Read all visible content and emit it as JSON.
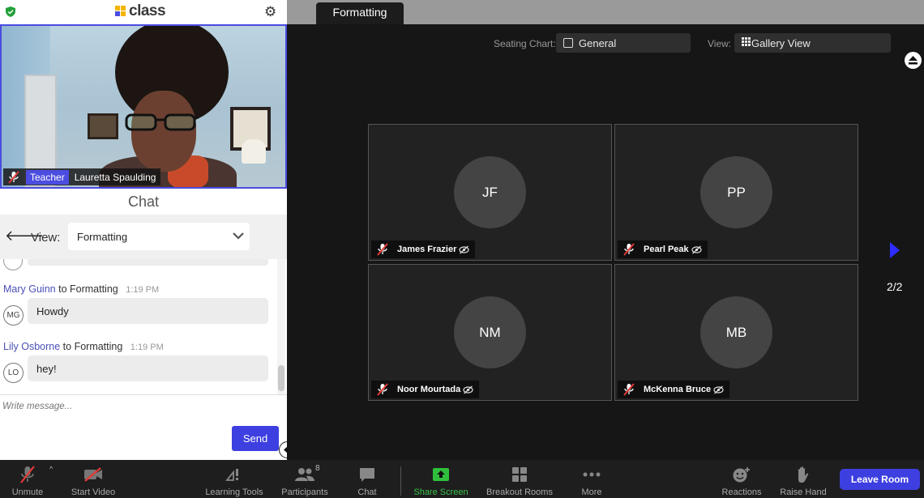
{
  "app": {
    "logo_text": "class"
  },
  "self_video": {
    "role_badge": "Teacher",
    "name": "Lauretta Spaulding"
  },
  "chat": {
    "title": "Chat",
    "view_label": "View:",
    "view_value": "Formatting",
    "messages": [
      {
        "sender": "Mary Guinn",
        "to_text": "to Formatting",
        "time": "1:19 PM",
        "initials": "MG",
        "text": "Howdy"
      },
      {
        "sender": "Lily Osborne",
        "to_text": "to Formatting",
        "time": "1:19 PM",
        "initials": "LO",
        "text": "hey!"
      }
    ],
    "compose_placeholder": "Write message...",
    "send_label": "Send"
  },
  "room_tab": "Formatting",
  "seating": {
    "label": "Seating Chart:",
    "value": "General"
  },
  "view_mode": {
    "label": "View:",
    "value": "Gallery View"
  },
  "participants": [
    {
      "initials": "JF",
      "name": "James Frazier"
    },
    {
      "initials": "PP",
      "name": "Pearl Peak"
    },
    {
      "initials": "NM",
      "name": "Noor Mourtada"
    },
    {
      "initials": "MB",
      "name": "McKenna Bruce"
    }
  ],
  "pager": "2/2",
  "toolbar": {
    "unmute": "Unmute",
    "start_video": "Start Video",
    "learning_tools": "Learning Tools",
    "participants": "Participants",
    "participants_count": "8",
    "chat": "Chat",
    "share_screen": "Share Screen",
    "breakout_rooms": "Breakout Rooms",
    "more": "More",
    "reactions": "Reactions",
    "raise_hand": "Raise Hand",
    "leave_room": "Leave Room"
  },
  "colors": {
    "accent": "#3d3fe0",
    "share_green": "#3cc24a",
    "stage_bg": "#161616",
    "sender_name": "#4a4fb8"
  },
  "icons": [
    "shield-icon",
    "gear-icon",
    "mic-off-icon",
    "back-arrow-icon",
    "chevron-down-icon",
    "eject-icon",
    "grid-icon",
    "eye-off-icon",
    "next-page-icon",
    "video-off-icon",
    "learning-tools-icon",
    "participants-icon",
    "chat-icon",
    "share-screen-icon",
    "breakout-rooms-icon",
    "more-icon",
    "reactions-icon",
    "raise-hand-icon"
  ]
}
